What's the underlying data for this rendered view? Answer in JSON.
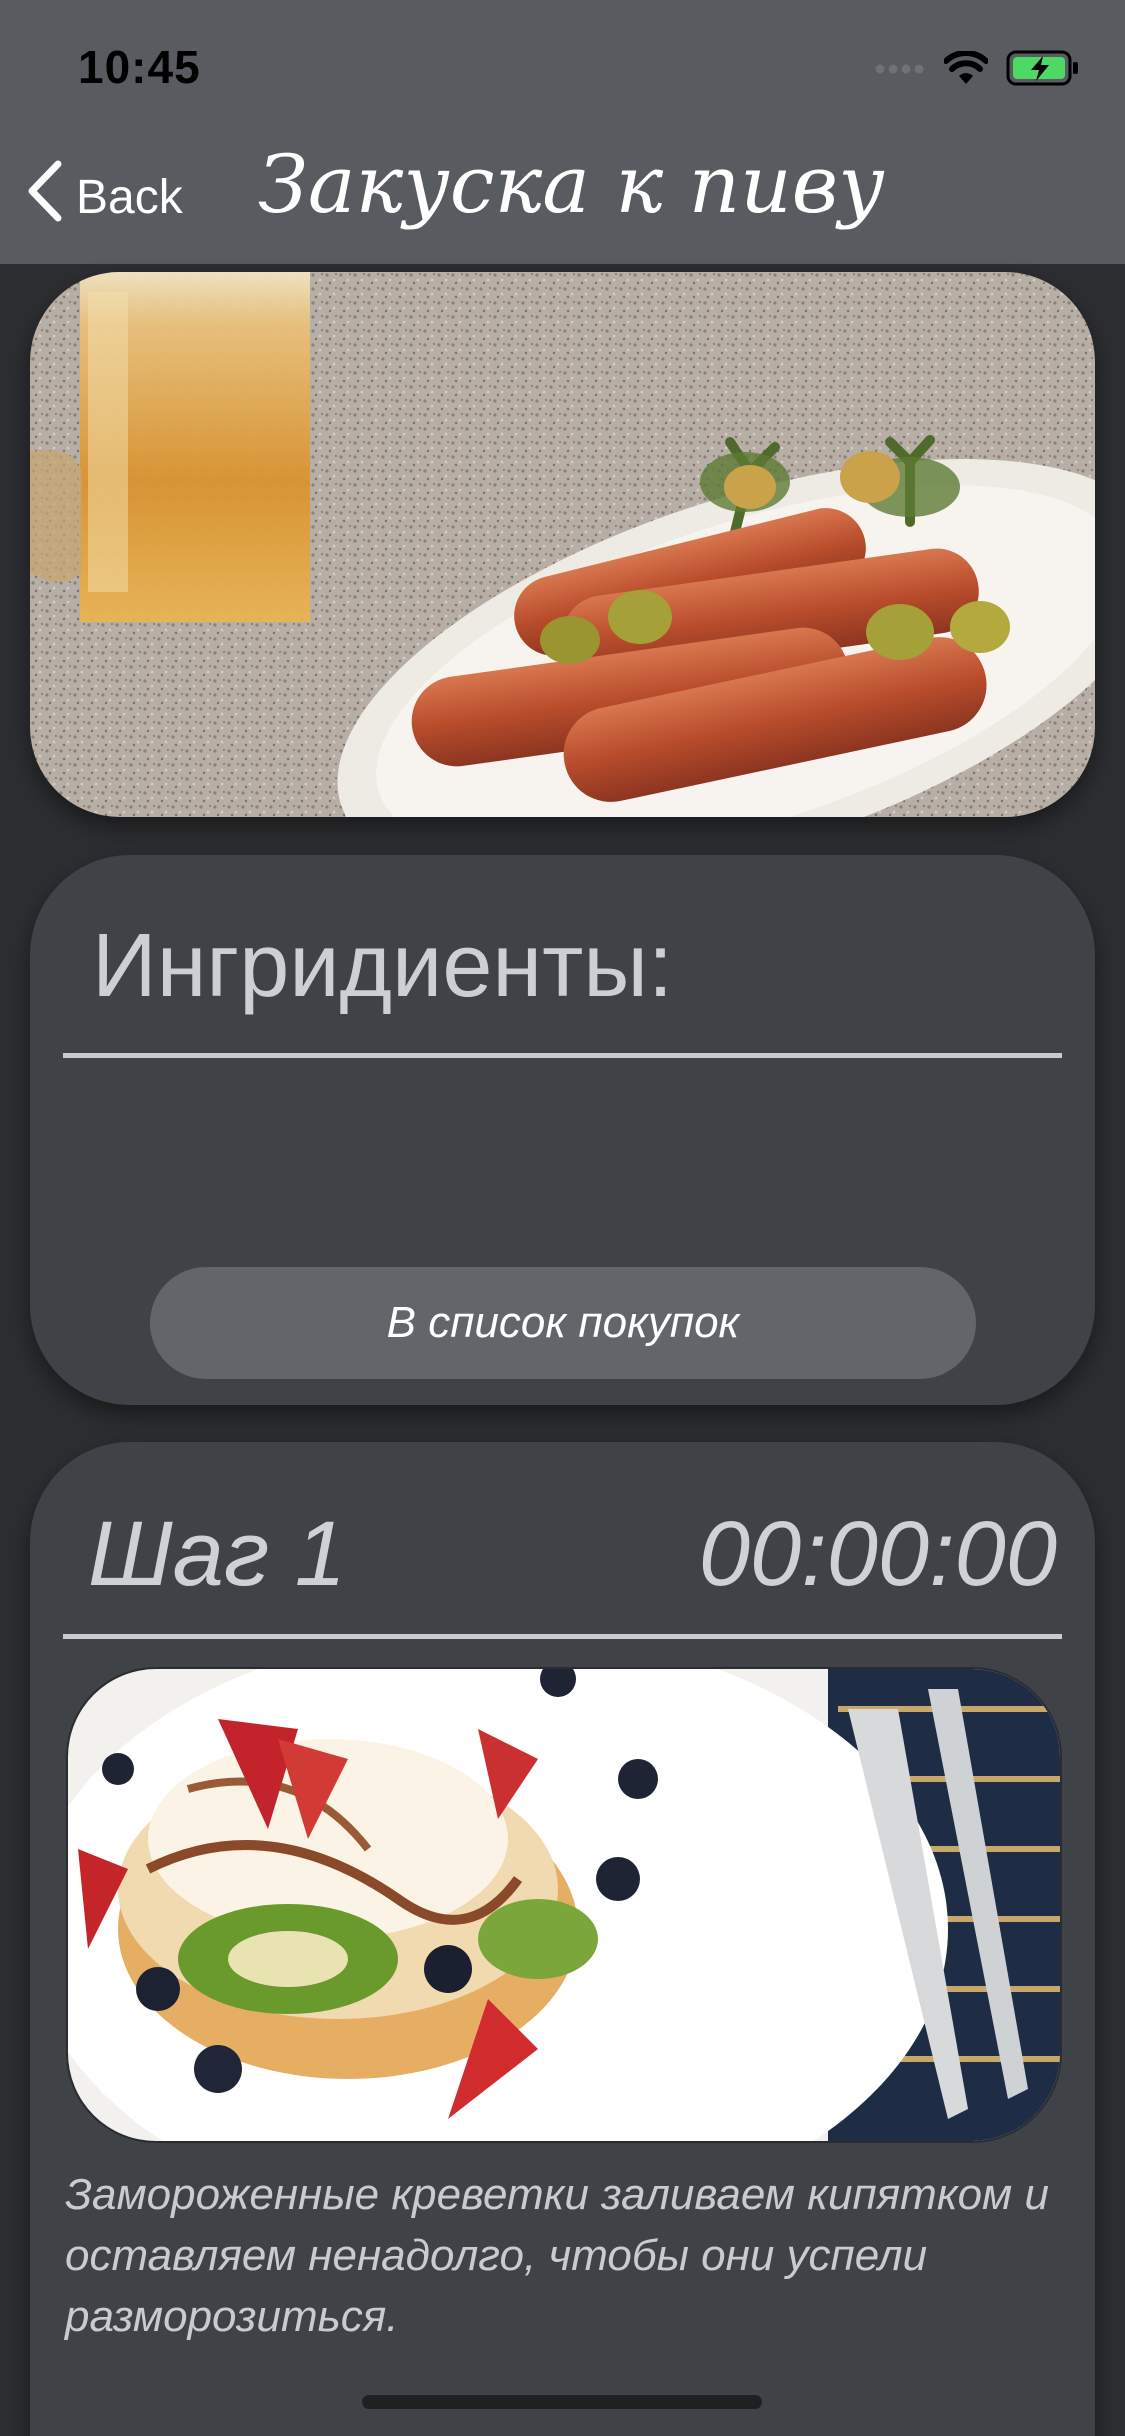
{
  "status_bar": {
    "time": "10:45"
  },
  "nav": {
    "back_label": "Back",
    "title": "Закуска к пиву"
  },
  "ingredients": {
    "title": "Ингридиенты:",
    "shopping_button": "В список покупок"
  },
  "step": {
    "title": "Шаг 1",
    "timer": "00:00:00",
    "description": "Замороженные креветки заливаем кипятком и оставляем ненадолго, чтобы они успели разморозиться."
  },
  "colors": {
    "nav_bg": "#585b5f",
    "screen_bg": "#2c2e31",
    "card_bg": "#3f4246",
    "button_bg": "#62656a",
    "battery_green": "#4cd964"
  }
}
